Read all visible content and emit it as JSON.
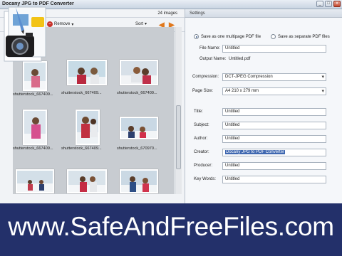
{
  "window": {
    "title": "Docany JPG to PDF Converter",
    "buttons": [
      "_",
      "□",
      "x"
    ]
  },
  "image_list": {
    "count_label": "24 images",
    "toolbar": {
      "remove_label": "Remove",
      "sort_label": "Sort"
    },
    "thumbnails": [
      {
        "caption": "shutterstock_667409..."
      },
      {
        "caption": "shutterstock_667409..."
      },
      {
        "caption": "shutterstock_667409..."
      },
      {
        "caption": "shutterstock_667409..."
      },
      {
        "caption": "shutterstock_667409..."
      },
      {
        "caption": "shutterstock_670970..."
      },
      {
        "caption": ""
      },
      {
        "caption": ""
      },
      {
        "caption": ""
      }
    ]
  },
  "settings": {
    "header": "Settings",
    "radio_multi": "Save as one multipage PDF file",
    "radio_separate": "Save as separate PDF files",
    "file_name_label": "File Name:",
    "file_name_value": "Untitled",
    "output_name_label": "Output Name:",
    "output_name_value": "Untitled.pdf",
    "compression_label": "Compression:",
    "compression_value": "DCT-JPEG Compression",
    "page_size_label": "Page Size:",
    "page_size_value": "A4 210 x 279 mm",
    "title_label": "Title:",
    "title_value": "Untitled",
    "subject_label": "Subject:",
    "subject_value": "Untitled",
    "author_label": "Author:",
    "author_value": "Untitled",
    "creator_label": "Creator:",
    "creator_value": "Docany JPG to PDF Converter",
    "producer_label": "Producer:",
    "producer_value": "Untitled",
    "keywords_label": "Key Words:",
    "keywords_value": "Untitled"
  },
  "banner": {
    "text": "www.SafeAndFreeFiles.com"
  },
  "colors": {
    "banner_bg": "#23306a",
    "accent_arrow": "#e0781c",
    "selection": "#3e67b0"
  }
}
